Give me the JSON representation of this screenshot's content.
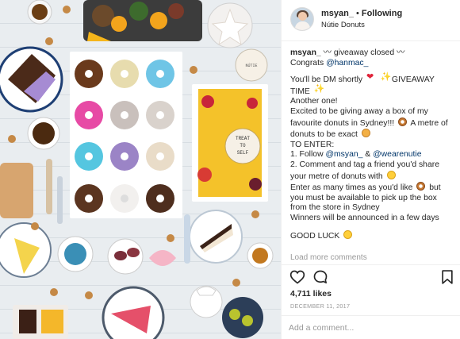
{
  "post": {
    "username": "msyan_",
    "separator": "•",
    "follow_status": "Following",
    "location": "Nútie Donuts"
  },
  "caption": {
    "line1_user": "msyan_",
    "line1_text": " 〰 giveaway closed 〰",
    "line2_prefix": "Congrats ",
    "line2_mention": "@hanmac_",
    "l1": "You'll be DM shortly ",
    "l1b": "GIVEAWAY",
    "l2": "TIME ",
    "l3": "Another one!",
    "l4": "Excited to be giving away a box of my",
    "l5a": "favourite donuts in Sydney!!! ",
    "l5b": " A metre of",
    "l6": "donuts to be exact ",
    "l7": "TO ENTER:",
    "l8_prefix": "1. Follow ",
    "l8_m1": "@msyan_",
    "l8_mid": " & ",
    "l8_m2": "@wearenutie",
    "l9": "2. Comment and tag a friend you'd share",
    "l10": "your metre of donuts with ",
    "l11a": "Enter as many times as you'd like ",
    "l11b": " but",
    "l12": "you must be available to pick up the box",
    "l13": "from the store in Sydney",
    "l14": "Winners will be announced in a few days",
    "l15": "GOOD LUCK "
  },
  "load_more": "Load more comments",
  "icons": {
    "like": "heart-outline-icon",
    "comment": "speech-bubble-icon",
    "save": "bookmark-icon"
  },
  "likes": "4,711 likes",
  "date": "DECEMBER 11, 2017",
  "comment_placeholder": "Add a comment...",
  "colors": {
    "mention": "#003569",
    "muted": "#999999",
    "text": "#262626",
    "divider": "#efefef"
  },
  "photo": {
    "description_icon": "donut-flatlay-photo",
    "sign_top": "NÚTIE",
    "sign_treat_1": "TREAT",
    "sign_treat_2": "TO",
    "sign_treat_3": "SELF",
    "heart_label": "NUTIE"
  }
}
